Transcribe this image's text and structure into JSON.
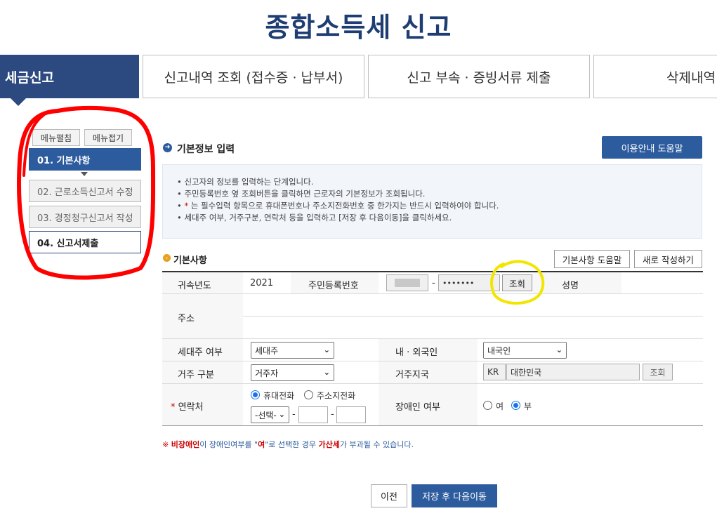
{
  "page_title": "종합소득세 신고",
  "tabs": [
    {
      "label": "세금신고"
    },
    {
      "label": "신고내역 조회 (접수증 · 납부서)"
    },
    {
      "label": "신고 부속 · 증빙서류 제출"
    },
    {
      "label": "삭제내역"
    }
  ],
  "sidebar": {
    "expand_label": "메뉴펼침",
    "collapse_label": "메뉴접기",
    "steps": [
      {
        "label": "01. 기본사항"
      },
      {
        "label": "02. 근로소득신고서 수정"
      },
      {
        "label": "03. 경정청구신고서 작성"
      },
      {
        "label": "04. 신고서제출"
      }
    ]
  },
  "section1": {
    "title": "기본정보 입력",
    "help_button": "이용안내 도움말",
    "notices": [
      "신고자의 정보를 입력하는 단계입니다.",
      "주민등록번호 옆 조회버튼을 클릭하면 근로자의 기본정보가 조회됩니다.",
      "는 필수입력 항목으로 휴대폰번호나 주소지전화번호 중 한가지는 반드시 입력하여야 합니다.",
      "세대주 여부, 거주구분, 연락처 등을 입력하고 [저장 후 다음이동]을 클릭하세요."
    ],
    "required_mark": "*"
  },
  "section2": {
    "title": "기본사항",
    "help_button": "기본사항 도움말",
    "new_button": "새로 작성하기"
  },
  "form": {
    "year_label": "귀속년도",
    "year_value": "2021",
    "rrn_label": "주민등록번호",
    "rrn_dash": "-",
    "rrn_back": "•••••••",
    "lookup_button": "조회",
    "name_label": "성명",
    "address_label": "주소",
    "householder_label": "세대주 여부",
    "householder_value": "세대주",
    "nationality_label": "내 · 외국인",
    "nationality_value": "내국인",
    "residence_label": "거주 구분",
    "residence_value": "거주자",
    "residence_country_label": "거주지국",
    "country_code": "KR",
    "country_name": "대한민국",
    "country_lookup": "조회",
    "contact_label": "연락처",
    "contact_required": "*",
    "mobile_label": "휴대전화",
    "home_phone_label": "주소지전화",
    "phone_select": "-선택-",
    "phone_dash1": "-",
    "phone_dash2": "-",
    "disability_label": "장애인 여부",
    "disability_yes": "여",
    "disability_no": "부"
  },
  "footnote": {
    "prefix": "※ ",
    "t1": "비장애인",
    "t2": "이 장애인여부를 \"",
    "t3": "여",
    "t4": "\"로 선택한 경우 ",
    "t5": "가산세",
    "t6": "가 부과될 수 있습니다."
  },
  "bottom": {
    "prev_button": "이전",
    "next_button": "저장 후 다음이동"
  },
  "colors": {
    "brand": "#1e3d73",
    "accent": "#2c5b9e",
    "annotation_red": "#ff0000",
    "annotation_yellow": "#f2e600"
  }
}
